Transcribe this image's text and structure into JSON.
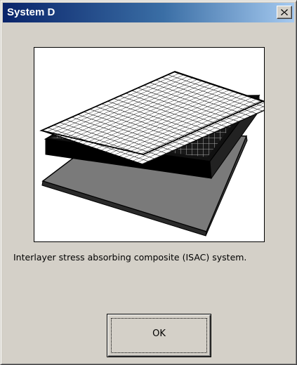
{
  "window": {
    "title": "System D",
    "close_glyph": "close-icon"
  },
  "content": {
    "image": "layered-grid-composite-illustration",
    "caption": "Interlayer stress absorbing composite (ISAC) system."
  },
  "buttons": {
    "ok_label": "OK"
  },
  "colors": {
    "title_gradient_start": "#0a246a",
    "title_gradient_end": "#a6caf0",
    "face": "#d4d0c8"
  }
}
